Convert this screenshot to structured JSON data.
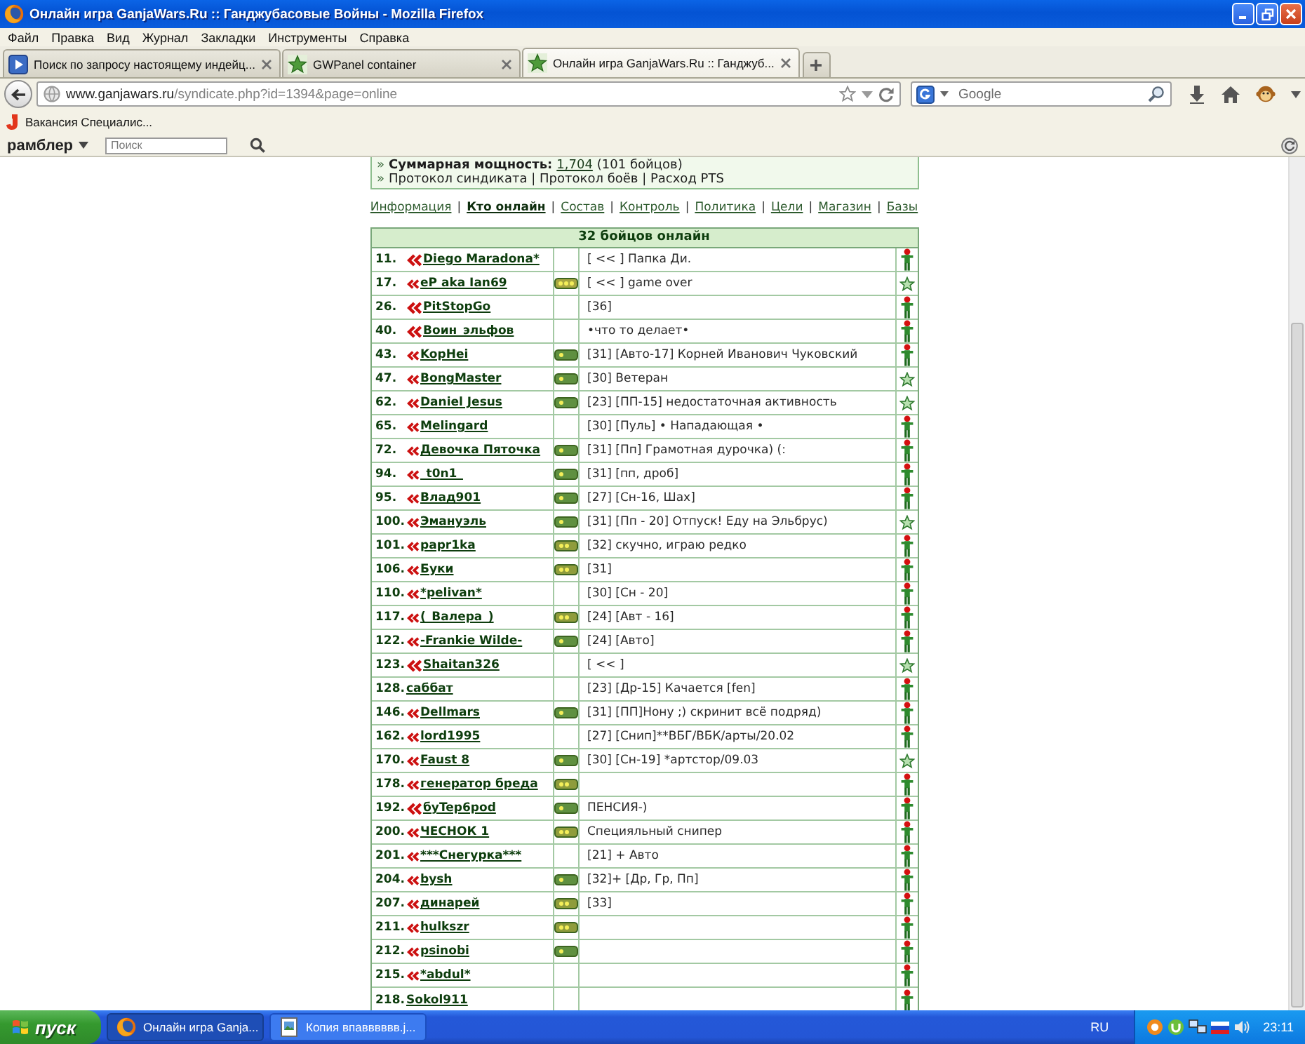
{
  "window": {
    "title": "Онлайн игра GanjaWars.Ru :: Ганджубасовые Войны - Mozilla Firefox"
  },
  "menu": [
    "Файл",
    "Правка",
    "Вид",
    "Журнал",
    "Закладки",
    "Инструменты",
    "Справка"
  ],
  "tabs": [
    {
      "label": "Поиск по запросу настоящему индейц...",
      "kind": "video",
      "selected": false
    },
    {
      "label": "GWPanel container",
      "kind": "game",
      "selected": false
    },
    {
      "label": "Онлайн игра GanjaWars.Ru :: Ганджуб...",
      "kind": "game",
      "selected": true
    }
  ],
  "navigation": {
    "address_host": "www.ganjawars.ru",
    "address_path": "/syndicate.php?id=1394&page=online",
    "search_placeholder": "Google"
  },
  "bookmarks": [
    {
      "label": "Вакансия Специалис..."
    }
  ],
  "rambler_bar": {
    "logo": "рамблер",
    "search_placeholder": "Поиск"
  },
  "syndicate": {
    "summary": {
      "bullet": "»",
      "label": "Суммарная мощность:",
      "value": "1,704",
      "count": "(101 бойцов)"
    },
    "protocols": {
      "bullet": "»",
      "text": "Протокол синдиката | Протокол боёв | Расход PTS"
    }
  },
  "section_nav": {
    "separator": "|",
    "links": [
      {
        "label": "Информация",
        "selected": false
      },
      {
        "label": "Кто онлайн",
        "selected": true
      },
      {
        "label": "Состав",
        "selected": false
      },
      {
        "label": "Контроль",
        "selected": false
      },
      {
        "label": "Политика",
        "selected": false
      },
      {
        "label": "Цели",
        "selected": false
      },
      {
        "label": "Магазин",
        "selected": false
      },
      {
        "label": "Базы",
        "selected": false
      }
    ]
  },
  "table": {
    "title": "32 бойцов онлайн",
    "rows": [
      {
        "number": "11.",
        "chevrons": {
          "kind": "large"
        },
        "name": "Diego Maradona*",
        "status": "[ << ] Папка Ди.",
        "figure": {
          "kind": "soldier"
        }
      },
      {
        "number": "17.",
        "chevrons": {
          "kind": "small"
        },
        "name": "eP aka Ian69",
        "rank_badge": {
          "kind": "triple"
        },
        "status": "[ << ] game over",
        "figure": {
          "kind": "star"
        }
      },
      {
        "number": "26.",
        "chevrons": {
          "kind": "large"
        },
        "name": "PitStopGo",
        "status": "[36]",
        "figure": {
          "kind": "soldier"
        }
      },
      {
        "number": "40.",
        "chevrons": {
          "kind": "large"
        },
        "name": "Воин_эльфов",
        "status": "•что то делает•",
        "figure": {
          "kind": "soldier"
        }
      },
      {
        "number": "43.",
        "chevrons": {
          "kind": "small"
        },
        "name": "KopHei",
        "rank_badge": {
          "kind": "single"
        },
        "status": "[31] [Авто-17] Корней Иванович Чуковский",
        "figure": {
          "kind": "soldier"
        }
      },
      {
        "number": "47.",
        "chevrons": {
          "kind": "small"
        },
        "name": "BongMaster",
        "rank_badge": {
          "kind": "single"
        },
        "status": "[30] Ветеран",
        "figure": {
          "kind": "star"
        }
      },
      {
        "number": "62.",
        "chevrons": {
          "kind": "small"
        },
        "name": "Daniel Jesus",
        "rank_badge": {
          "kind": "single"
        },
        "status": "[23] [ПП-15] недостаточная активность",
        "figure": {
          "kind": "star"
        }
      },
      {
        "number": "65.",
        "chevrons": {
          "kind": "small"
        },
        "name": "Melingard",
        "status": "[30] [Пуль] • Нападающая •",
        "figure": {
          "kind": "soldier"
        }
      },
      {
        "number": "72.",
        "chevrons": {
          "kind": "small"
        },
        "name": "Девочка Пяточка",
        "rank_badge": {
          "kind": "single"
        },
        "status": "[31] [Пп] Грамотная дурочка) (:",
        "figure": {
          "kind": "soldier"
        }
      },
      {
        "number": "94.",
        "chevrons": {
          "kind": "small"
        },
        "name": "_t0n1_",
        "rank_badge": {
          "kind": "single"
        },
        "status": "[31] [пп, дроб]",
        "figure": {
          "kind": "soldier"
        }
      },
      {
        "number": "95.",
        "chevrons": {
          "kind": "small"
        },
        "name": "Влад901",
        "rank_badge": {
          "kind": "single"
        },
        "status": "[27] [Сн-16, Шах]",
        "figure": {
          "kind": "soldier"
        }
      },
      {
        "number": "100.",
        "chevrons": {
          "kind": "small"
        },
        "name": "Эмануэль",
        "rank_badge": {
          "kind": "single"
        },
        "status": "[31] [Пп - 20] Отпуск! Еду на Эльбрус)",
        "figure": {
          "kind": "star"
        }
      },
      {
        "number": "101.",
        "chevrons": {
          "kind": "small"
        },
        "name": "papr1ka",
        "rank_badge": {
          "kind": "double"
        },
        "status": "[32] скучно, играю редко",
        "figure": {
          "kind": "soldier"
        }
      },
      {
        "number": "106.",
        "chevrons": {
          "kind": "small"
        },
        "name": "Буки",
        "rank_badge": {
          "kind": "double"
        },
        "status": "[31]",
        "figure": {
          "kind": "soldier"
        }
      },
      {
        "number": "110.",
        "chevrons": {
          "kind": "small"
        },
        "name": "*pelivan*",
        "status": "[30] [Сн - 20]",
        "figure": {
          "kind": "soldier"
        }
      },
      {
        "number": "117.",
        "chevrons": {
          "kind": "small"
        },
        "name": "(_Валера_)",
        "rank_badge": {
          "kind": "double"
        },
        "status": "[24] [Авт - 16]",
        "figure": {
          "kind": "soldier"
        }
      },
      {
        "number": "122.",
        "chevrons": {
          "kind": "small"
        },
        "name": "-Frankie Wilde-",
        "rank_badge": {
          "kind": "single"
        },
        "status": "[24] [Авто]",
        "figure": {
          "kind": "soldier"
        }
      },
      {
        "number": "123.",
        "chevrons": {
          "kind": "large"
        },
        "name": "Shaitan326",
        "status": "[ << ]",
        "figure": {
          "kind": "star"
        }
      },
      {
        "number": "128.",
        "name": "саббат",
        "status": "[23] [Др-15] Качается [fen]",
        "figure": {
          "kind": "soldier"
        }
      },
      {
        "number": "146.",
        "chevrons": {
          "kind": "small"
        },
        "name": "Dellmars",
        "rank_badge": {
          "kind": "single"
        },
        "status": "[31] [ПП]Нону ;) скринит всё подряд)",
        "figure": {
          "kind": "soldier"
        }
      },
      {
        "number": "162.",
        "chevrons": {
          "kind": "small"
        },
        "name": "lord1995",
        "status": "[27] [Снип]**ВБГ/ВБК/арты/20.02",
        "figure": {
          "kind": "soldier"
        }
      },
      {
        "number": "170.",
        "chevrons": {
          "kind": "small"
        },
        "name": "Faust 8",
        "rank_badge": {
          "kind": "single"
        },
        "status": "[30] [Сн-19] *артстор/09.03",
        "figure": {
          "kind": "star"
        }
      },
      {
        "number": "178.",
        "chevrons": {
          "kind": "small"
        },
        "name": "генератор бреда",
        "rank_badge": {
          "kind": "double"
        },
        "figure": {
          "kind": "soldier"
        }
      },
      {
        "number": "192.",
        "chevrons": {
          "kind": "large"
        },
        "name": "бyTep6pod",
        "rank_badge": {
          "kind": "single"
        },
        "status": "ПЕНСИЯ-)",
        "figure": {
          "kind": "soldier"
        }
      },
      {
        "number": "200.",
        "chevrons": {
          "kind": "small"
        },
        "name": "ЧЕСНОК 1",
        "rank_badge": {
          "kind": "double"
        },
        "status": "Специяльный снипер",
        "figure": {
          "kind": "soldier"
        }
      },
      {
        "number": "201.",
        "chevrons": {
          "kind": "small"
        },
        "name": "***Снегурка***",
        "status": "[21] + Авто",
        "figure": {
          "kind": "soldier"
        }
      },
      {
        "number": "204.",
        "chevrons": {
          "kind": "small"
        },
        "name": "bysh",
        "rank_badge": {
          "kind": "single"
        },
        "status": "[32]+ [Др, Гр, Пп]",
        "figure": {
          "kind": "soldier"
        }
      },
      {
        "number": "207.",
        "chevrons": {
          "kind": "small"
        },
        "name": "динарей",
        "rank_badge": {
          "kind": "double"
        },
        "status": "[33]",
        "figure": {
          "kind": "soldier"
        }
      },
      {
        "number": "211.",
        "chevrons": {
          "kind": "small"
        },
        "name": "hulkszr",
        "rank_badge": {
          "kind": "double"
        },
        "figure": {
          "kind": "soldier"
        }
      },
      {
        "number": "212.",
        "chevrons": {
          "kind": "small"
        },
        "name": "psinobi",
        "rank_badge": {
          "kind": "single"
        },
        "figure": {
          "kind": "soldier"
        }
      },
      {
        "number": "215.",
        "chevrons": {
          "kind": "small"
        },
        "name": "*abdul*",
        "figure": {
          "kind": "soldier"
        }
      },
      {
        "number": "218.",
        "name": "Sokol911",
        "figure": {
          "kind": "soldier"
        }
      }
    ]
  },
  "taskbar": {
    "start": "пуск",
    "tasks": [
      {
        "label": "Онлайн игра Ganja...",
        "kind": "browser",
        "selected": true
      },
      {
        "label": "Копия впавввввв.j...",
        "kind": "image",
        "selected": false
      }
    ],
    "language": "RU",
    "clock": "23:11"
  }
}
